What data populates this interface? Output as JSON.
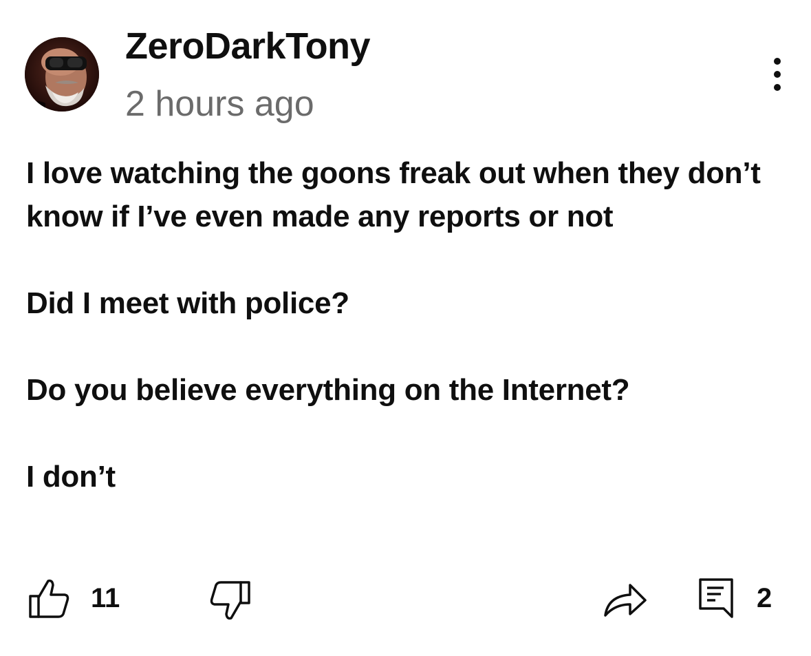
{
  "comment": {
    "author": "ZeroDarkTony",
    "timestamp": "2 hours ago",
    "body": [
      "I love watching the goons freak out when they don’t know if I’ve even made any reports or not",
      "Did I meet with police?",
      "Do you believe everything on the Internet?",
      "I don’t"
    ],
    "likes": "11",
    "replies": "2"
  },
  "icons": {
    "avatar": "user-avatar",
    "more": "more-vertical-icon",
    "like": "thumbs-up-icon",
    "dislike": "thumbs-down-icon",
    "share": "share-arrow-icon",
    "reply": "comment-reply-icon"
  },
  "colors": {
    "text": "#0f0f0f",
    "secondary_text": "#6b6b6b",
    "background": "#ffffff"
  }
}
